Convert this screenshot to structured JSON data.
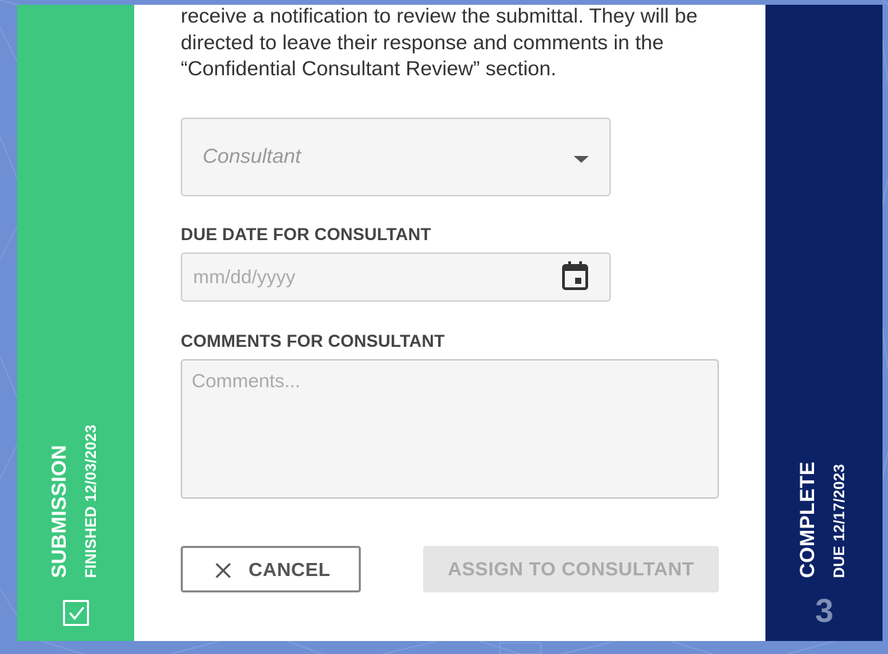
{
  "intro_text": "receive a notification to review the submittal. They will be directed to leave their response and comments in the “Confidential Consultant Review” section.",
  "consultant_select": {
    "placeholder": "Consultant"
  },
  "due_date": {
    "label": "DUE DATE FOR CONSULTANT",
    "placeholder": "mm/dd/yyyy"
  },
  "comments": {
    "label": "COMMENTS FOR CONSULTANT",
    "placeholder": "Comments..."
  },
  "buttons": {
    "cancel_label": "CANCEL",
    "assign_label": "ASSIGN TO CONSULTANT"
  },
  "left_step": {
    "title": "SUBMISSION",
    "subtitle": "FINISHED 12/03/2023",
    "status_icon": "checkbox-checked-icon",
    "color": "#3dc77f"
  },
  "right_step": {
    "title": "COMPLETE",
    "subtitle": "DUE 12/17/2023",
    "number": "3",
    "color": "#0c2266"
  },
  "colors": {
    "background": "#6f8fd4",
    "card": "#ffffff"
  }
}
